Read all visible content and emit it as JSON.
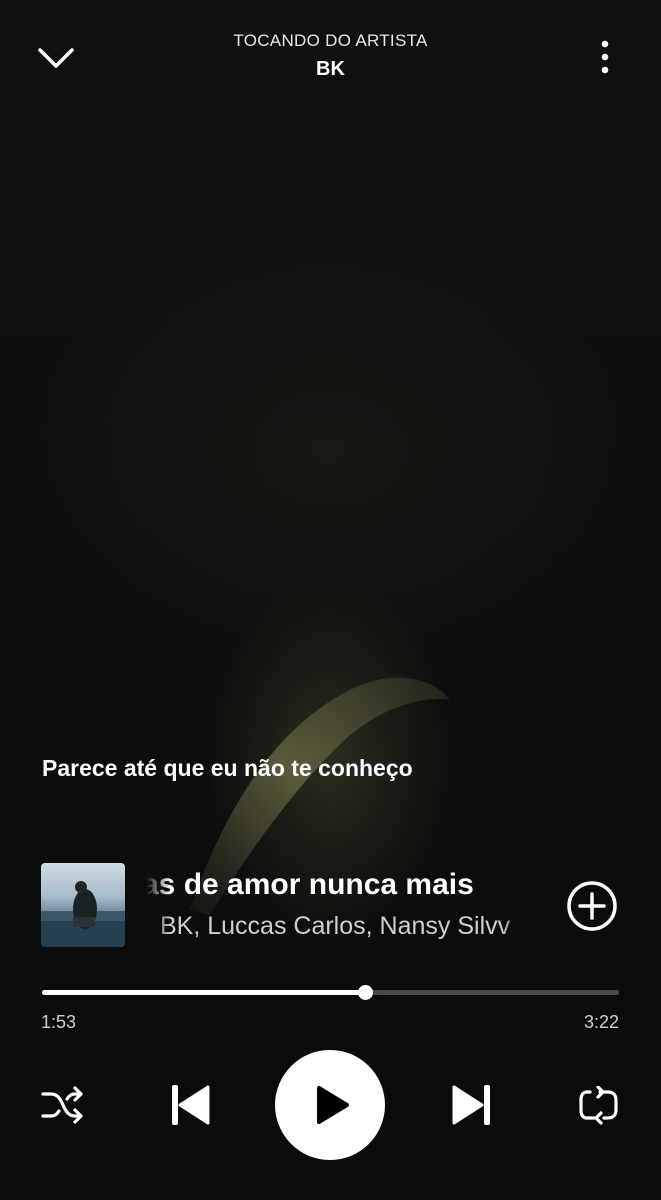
{
  "header": {
    "context_label": "TOCANDO DO ARTISTA",
    "artist": "BK"
  },
  "lyrics": {
    "current_line": "Parece até que eu não te conheço"
  },
  "track": {
    "title_visible": "as de amor nunca mais",
    "artists_visible": "BK, Luccas Carlos, Nansy Silvv"
  },
  "progress": {
    "elapsed": "1:53",
    "total": "3:22",
    "fraction": 0.559
  },
  "icons": {
    "collapse": "chevron-down-icon",
    "menu": "more-vertical-icon",
    "add": "add-circle-icon",
    "shuffle": "shuffle-icon",
    "previous": "skip-previous-icon",
    "play": "play-icon",
    "next": "skip-next-icon",
    "repeat": "repeat-icon"
  },
  "colors": {
    "background": "#0d0f0d",
    "progress_fill": "#ffffff",
    "progress_track": "#4a4a4a"
  }
}
